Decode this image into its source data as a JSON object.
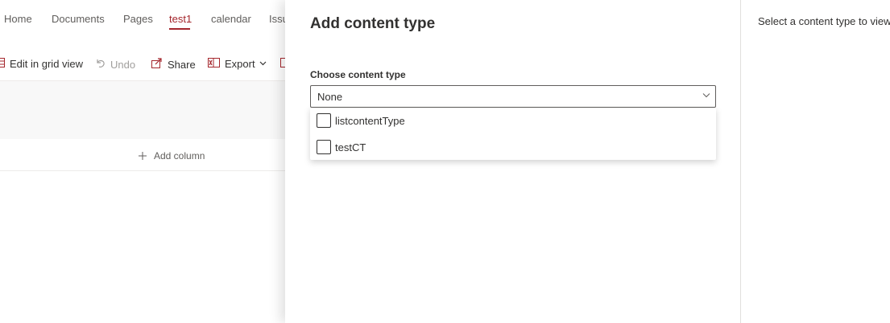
{
  "nav": {
    "items": [
      {
        "label": "Home",
        "active": false
      },
      {
        "label": "Documents",
        "active": false
      },
      {
        "label": "Pages",
        "active": false
      },
      {
        "label": "test1",
        "active": true
      },
      {
        "label": "calendar",
        "active": false
      },
      {
        "label": "Issu",
        "active": false
      }
    ]
  },
  "commandbar": {
    "edit_grid": "Edit in grid view",
    "undo": "Undo",
    "share": "Share",
    "export": "Export"
  },
  "list": {
    "add_column": "Add column"
  },
  "panel": {
    "title": "Add content type",
    "field_label": "Choose content type",
    "dropdown_value": "None",
    "options": [
      {
        "label": "listcontentType",
        "checked": false
      },
      {
        "label": "testCT",
        "checked": false
      }
    ],
    "preview_text": "Select a content type to view"
  },
  "colors": {
    "accent": "#a4262c",
    "text": "#323130",
    "muted": "#605e5c"
  }
}
